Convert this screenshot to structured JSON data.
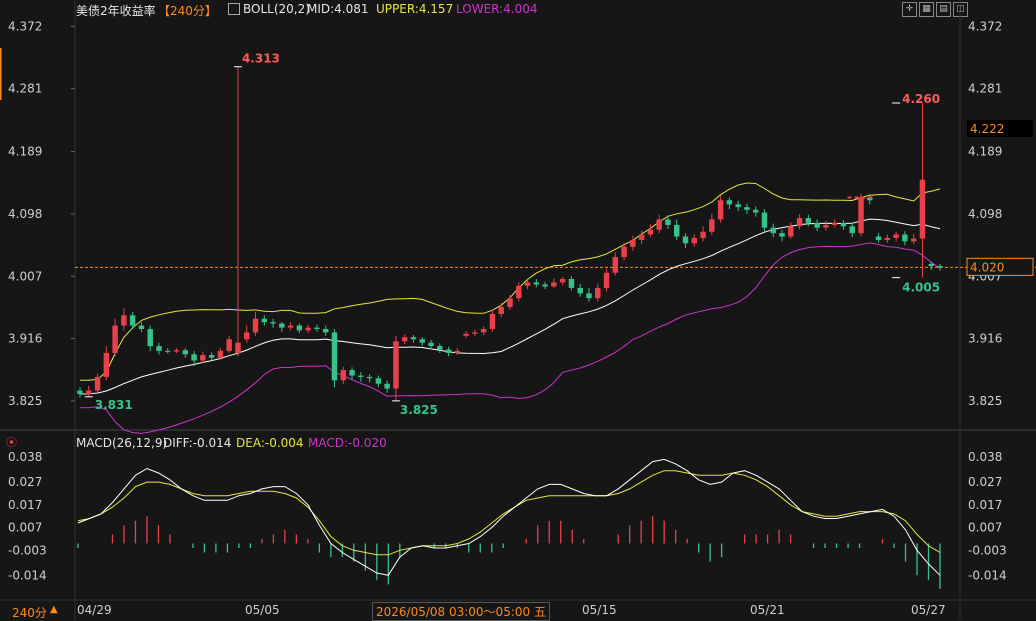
{
  "header": {
    "title": "美债2年收益率",
    "period_tag": "【240分】",
    "boll_label": "BOLL(20,2)",
    "mid_label": "MID:4.081",
    "upper_label": "UPPER:4.157",
    "lower_label": "LOWER:4.004"
  },
  "macd_header": {
    "label": "MACD(26,12,9)",
    "diff_label": "DIFF:-0.014",
    "dea_label": "DEA:-0.004",
    "macd_label": "MACD:-0.020"
  },
  "footer": {
    "period_button": "240分",
    "crosshair_time": "2026/05/08 03:00～05:00 五"
  },
  "colors": {
    "up": "#e8414a",
    "down": "#37c28a",
    "mid": "#ffffff",
    "upper": "#e6e63c",
    "lower": "#cc33cc",
    "macd_dea": "#e6e63c",
    "macd_diff": "#ffffff"
  },
  "chart_data": [
    {
      "type": "candlestick",
      "y_ticks": [
        "4.372",
        "4.281",
        "4.189",
        "4.098",
        "4.007",
        "3.916",
        "3.825"
      ],
      "ylim": [
        3.8,
        4.39
      ],
      "x_labels": [
        "04/29",
        "05/05",
        "05/15",
        "05/21",
        "05/27"
      ],
      "current_price": "4.020",
      "hover_price": "4.222",
      "annotations": {
        "high_1": "4.313",
        "low_1": "3.831",
        "low_2": "3.825",
        "high_2": "4.260",
        "low_3": "4.005"
      },
      "candles": [
        [
          3.84,
          3.835,
          3.845,
          3.83
        ],
        [
          3.835,
          3.84,
          3.847,
          3.831
        ],
        [
          3.84,
          3.86,
          3.865,
          3.838
        ],
        [
          3.86,
          3.895,
          3.905,
          3.855
        ],
        [
          3.895,
          3.935,
          3.945,
          3.89
        ],
        [
          3.935,
          3.95,
          3.96,
          3.928
        ],
        [
          3.95,
          3.935,
          3.955,
          3.93
        ],
        [
          3.935,
          3.93,
          3.94,
          3.925
        ],
        [
          3.93,
          3.905,
          3.935,
          3.898
        ],
        [
          3.905,
          3.898,
          3.91,
          3.893
        ],
        [
          3.898,
          3.897,
          3.902,
          3.894
        ],
        [
          3.897,
          3.899,
          3.902,
          3.895
        ],
        [
          3.899,
          3.893,
          3.902,
          3.888
        ],
        [
          3.893,
          3.884,
          3.898,
          3.876
        ],
        [
          3.884,
          3.892,
          3.897,
          3.88
        ],
        [
          3.892,
          3.888,
          3.896,
          3.884
        ],
        [
          3.888,
          3.898,
          3.902,
          3.885
        ],
        [
          3.898,
          3.915,
          3.92,
          3.895
        ],
        [
          3.895,
          3.91,
          4.313,
          3.89
        ],
        [
          3.915,
          3.925,
          3.935,
          3.91
        ],
        [
          3.925,
          3.945,
          3.955,
          3.92
        ],
        [
          3.945,
          3.94,
          3.95,
          3.935
        ],
        [
          3.94,
          3.938,
          3.945,
          3.932
        ],
        [
          3.938,
          3.932,
          3.94,
          3.926
        ],
        [
          3.932,
          3.935,
          3.94,
          3.928
        ],
        [
          3.935,
          3.928,
          3.938,
          3.924
        ],
        [
          3.928,
          3.932,
          3.936,
          3.924
        ],
        [
          3.932,
          3.93,
          3.936,
          3.926
        ],
        [
          3.93,
          3.925,
          3.935,
          3.92
        ],
        [
          3.925,
          3.855,
          3.93,
          3.845
        ],
        [
          3.855,
          3.87,
          3.875,
          3.85
        ],
        [
          3.87,
          3.862,
          3.874,
          3.856
        ],
        [
          3.862,
          3.86,
          3.867,
          3.853
        ],
        [
          3.86,
          3.858,
          3.864,
          3.852
        ],
        [
          3.858,
          3.85,
          3.862,
          3.845
        ],
        [
          3.85,
          3.843,
          3.855,
          3.837
        ],
        [
          3.843,
          3.912,
          3.92,
          3.825
        ],
        [
          3.912,
          3.918,
          3.922,
          3.908
        ],
        [
          3.918,
          3.915,
          3.921,
          3.91
        ],
        [
          3.915,
          3.91,
          3.918,
          3.905
        ],
        [
          3.91,
          3.905,
          3.914,
          3.9
        ],
        [
          3.905,
          3.9,
          3.909,
          3.895
        ],
        [
          3.9,
          3.895,
          3.904,
          3.89
        ],
        [
          3.895,
          3.898,
          3.902,
          3.892
        ],
        [
          3.92,
          3.923,
          3.927,
          3.917
        ],
        [
          3.923,
          3.925,
          3.929,
          3.92
        ],
        [
          3.925,
          3.93,
          3.934,
          3.921
        ],
        [
          3.93,
          3.952,
          3.958,
          3.926
        ],
        [
          3.952,
          3.962,
          3.968,
          3.947
        ],
        [
          3.962,
          3.975,
          3.98,
          3.958
        ],
        [
          3.975,
          3.993,
          3.998,
          3.97
        ],
        [
          3.993,
          3.998,
          4.002,
          3.988
        ],
        [
          3.998,
          3.995,
          4.003,
          3.991
        ],
        [
          3.995,
          3.992,
          3.999,
          3.988
        ],
        [
          3.992,
          3.998,
          4.004,
          3.99
        ],
        [
          3.998,
          4.003,
          4.006,
          3.994
        ],
        [
          4.003,
          3.99,
          4.007,
          3.986
        ],
        [
          3.99,
          3.982,
          3.996,
          3.977
        ],
        [
          3.982,
          3.975,
          3.99,
          3.97
        ],
        [
          3.975,
          3.99,
          3.996,
          3.97
        ],
        [
          3.99,
          4.012,
          4.018,
          3.985
        ],
        [
          4.012,
          4.035,
          4.042,
          4.008
        ],
        [
          4.035,
          4.05,
          4.056,
          4.03
        ],
        [
          4.05,
          4.06,
          4.066,
          4.044
        ],
        [
          4.06,
          4.068,
          4.074,
          4.054
        ],
        [
          4.068,
          4.075,
          4.083,
          4.064
        ],
        [
          4.075,
          4.09,
          4.097,
          4.07
        ],
        [
          4.09,
          4.082,
          4.096,
          4.076
        ],
        [
          4.082,
          4.065,
          4.09,
          4.06
        ],
        [
          4.065,
          4.055,
          4.07,
          4.048
        ],
        [
          4.055,
          4.063,
          4.068,
          4.05
        ],
        [
          4.063,
          4.072,
          4.08,
          4.058
        ],
        [
          4.072,
          4.09,
          4.098,
          4.067
        ],
        [
          4.09,
          4.118,
          4.125,
          4.085
        ],
        [
          4.118,
          4.112,
          4.122,
          4.105
        ],
        [
          4.112,
          4.108,
          4.117,
          4.102
        ],
        [
          4.108,
          4.104,
          4.113,
          4.098
        ],
        [
          4.104,
          4.1,
          4.109,
          4.094
        ],
        [
          4.1,
          4.078,
          4.105,
          4.072
        ],
        [
          4.078,
          4.07,
          4.084,
          4.064
        ],
        [
          4.07,
          4.065,
          4.075,
          4.058
        ],
        [
          4.065,
          4.08,
          4.086,
          4.062
        ],
        [
          4.08,
          4.092,
          4.098,
          4.076
        ],
        [
          4.092,
          4.085,
          4.097,
          4.08
        ],
        [
          4.085,
          4.078,
          4.09,
          4.073
        ],
        [
          4.078,
          4.082,
          4.088,
          4.074
        ],
        [
          4.082,
          4.085,
          4.09,
          4.078
        ],
        [
          4.085,
          4.08,
          4.089,
          4.075
        ],
        [
          4.08,
          4.07,
          4.085,
          4.064
        ],
        [
          4.07,
          4.122,
          4.128,
          4.066
        ],
        [
          4.122,
          4.118,
          4.127,
          4.112
        ],
        [
          4.065,
          4.06,
          4.07,
          4.056
        ],
        [
          4.06,
          4.063,
          4.068,
          4.056
        ],
        [
          4.063,
          4.068,
          4.072,
          4.058
        ],
        [
          4.068,
          4.058,
          4.073,
          4.052
        ],
        [
          4.058,
          4.062,
          4.069,
          4.054
        ],
        [
          4.062,
          4.148,
          4.26,
          4.005
        ],
        [
          4.025,
          4.022,
          4.028,
          4.016
        ],
        [
          4.022,
          4.02,
          4.025,
          4.015
        ]
      ]
    },
    {
      "type": "macd",
      "y_ticks": [
        "0.038",
        "0.027",
        "0.017",
        "0.007",
        "-0.003",
        "-0.014"
      ],
      "ylim": [
        -0.024,
        0.042
      ],
      "diff": [
        0.009,
        0.011,
        0.013,
        0.018,
        0.024,
        0.03,
        0.033,
        0.031,
        0.028,
        0.024,
        0.021,
        0.019,
        0.019,
        0.019,
        0.021,
        0.022,
        0.024,
        0.025,
        0.025,
        0.022,
        0.017,
        0.008,
        0.0,
        -0.004,
        -0.007,
        -0.01,
        -0.013,
        -0.014,
        -0.006,
        -0.002,
        -0.001,
        -0.002,
        -0.002,
        -0.001,
        0.0,
        0.003,
        0.007,
        0.012,
        0.016,
        0.02,
        0.024,
        0.026,
        0.026,
        0.024,
        0.022,
        0.021,
        0.021,
        0.024,
        0.028,
        0.032,
        0.036,
        0.037,
        0.035,
        0.032,
        0.028,
        0.026,
        0.027,
        0.031,
        0.032,
        0.03,
        0.027,
        0.024,
        0.019,
        0.014,
        0.012,
        0.011,
        0.011,
        0.012,
        0.013,
        0.014,
        0.015,
        0.012,
        0.006,
        -0.003,
        -0.009,
        -0.014
      ],
      "dea": [
        0.01,
        0.011,
        0.013,
        0.016,
        0.02,
        0.025,
        0.027,
        0.027,
        0.026,
        0.024,
        0.022,
        0.021,
        0.021,
        0.021,
        0.022,
        0.023,
        0.023,
        0.023,
        0.022,
        0.02,
        0.016,
        0.01,
        0.003,
        -0.001,
        -0.003,
        -0.004,
        -0.005,
        -0.005,
        -0.003,
        -0.002,
        -0.001,
        -0.001,
        -0.001,
        0.0,
        0.002,
        0.005,
        0.009,
        0.013,
        0.016,
        0.019,
        0.02,
        0.021,
        0.021,
        0.021,
        0.021,
        0.021,
        0.021,
        0.022,
        0.024,
        0.027,
        0.03,
        0.032,
        0.032,
        0.031,
        0.03,
        0.03,
        0.03,
        0.031,
        0.03,
        0.028,
        0.025,
        0.021,
        0.017,
        0.014,
        0.013,
        0.012,
        0.012,
        0.013,
        0.014,
        0.014,
        0.014,
        0.013,
        0.01,
        0.004,
        -0.001,
        -0.004
      ],
      "x_labels": [
        "04/29",
        "05/05",
        "05/15",
        "05/21",
        "05/27"
      ]
    }
  ]
}
